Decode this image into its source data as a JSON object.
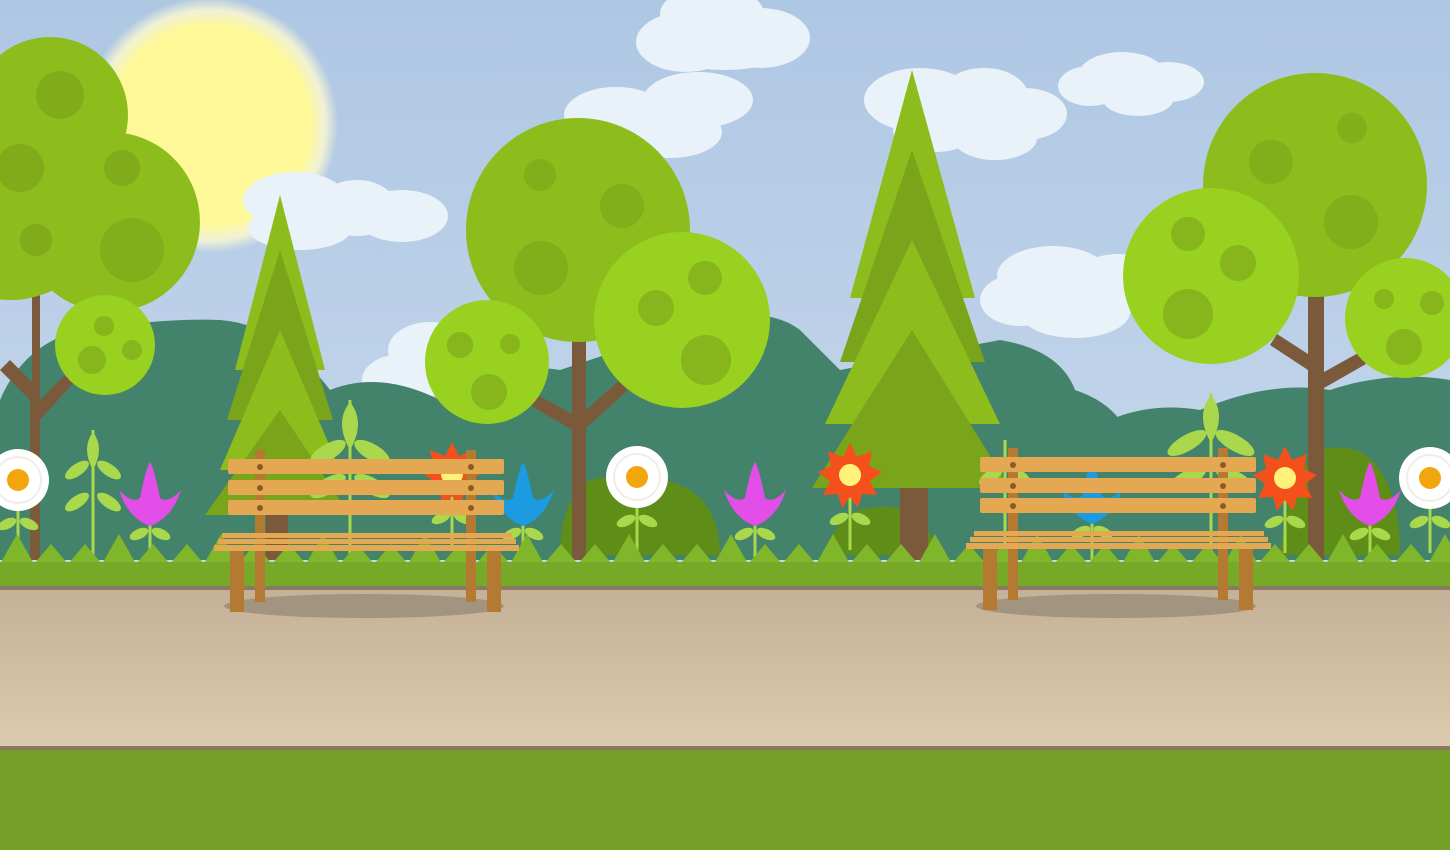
{
  "scene": {
    "colors": {
      "sky_top": "#aec7e3",
      "sky_bottom": "#c7d9ec",
      "sun": "#fff899",
      "sun_glow": "#fffbd0",
      "cloud": "#e9f1f9",
      "hills": "#43826b",
      "tree_light": "#98d11f",
      "tree_mid": "#8cbd1c",
      "tree_dark": "#7aa41a",
      "trunk": "#7b5a3c",
      "bush": "#5e8e18",
      "grass_spikes": "#7fb62a",
      "grass_strip": "#78a828",
      "path_top": "#c4b197",
      "path_bottom": "#dccbae",
      "path_edge": "#8a7a63",
      "lawn": "#74a027",
      "bench_wood": "#e4a853",
      "bench_legs": "#b47a32",
      "bench_bolts": "#8c5a22",
      "shadow": "#a3947f",
      "flower_white": "#ffffff",
      "flower_center": "#f2a60d",
      "flower_red": "#f5501c",
      "flower_magenta": "#e34ee8",
      "flower_blue": "#1c9be0",
      "leaf": "#a9d84c"
    },
    "icons": [
      "sun-icon",
      "cloud-icon",
      "round-tree-icon",
      "pine-tree-icon",
      "bench-icon",
      "daisy-icon",
      "tulip-icon",
      "gerbera-icon",
      "sprout-icon"
    ]
  }
}
